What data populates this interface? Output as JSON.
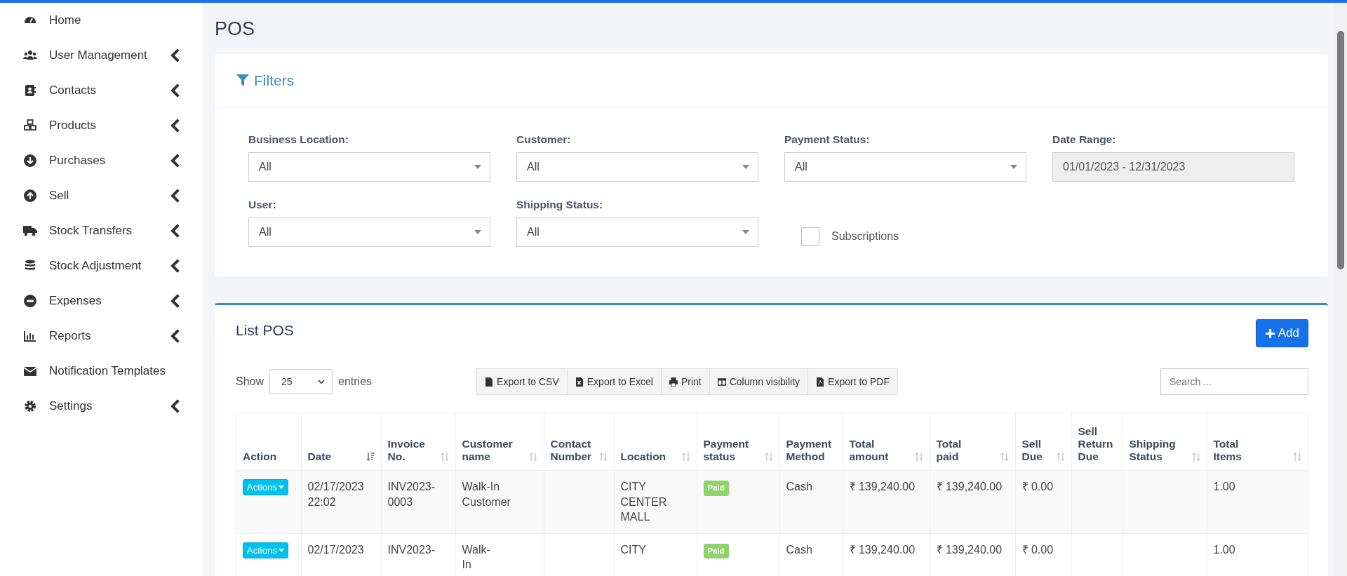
{
  "sidebar": {
    "items": [
      {
        "label": "Home",
        "expandable": false
      },
      {
        "label": "User Management",
        "expandable": true
      },
      {
        "label": "Contacts",
        "expandable": true
      },
      {
        "label": "Products",
        "expandable": true
      },
      {
        "label": "Purchases",
        "expandable": true
      },
      {
        "label": "Sell",
        "expandable": true
      },
      {
        "label": "Stock Transfers",
        "expandable": true
      },
      {
        "label": "Stock Adjustment",
        "expandable": true
      },
      {
        "label": "Expenses",
        "expandable": true
      },
      {
        "label": "Reports",
        "expandable": true
      },
      {
        "label": "Notification Templates",
        "expandable": false
      },
      {
        "label": "Settings",
        "expandable": true
      }
    ]
  },
  "page_title": "POS",
  "filters": {
    "title": "Filters",
    "fields": [
      {
        "kind": "select",
        "label": "Business Location:",
        "value": "All"
      },
      {
        "kind": "select",
        "label": "Customer:",
        "value": "All"
      },
      {
        "kind": "select",
        "label": "Payment Status:",
        "value": "All"
      },
      {
        "kind": "date",
        "label": "Date Range:",
        "value": "01/01/2023 - 12/31/2023"
      },
      {
        "kind": "select",
        "label": "User:",
        "value": "All"
      },
      {
        "kind": "select",
        "label": "Shipping Status:",
        "value": "All"
      },
      {
        "kind": "checkbox",
        "label": "Subscriptions",
        "checked": false
      }
    ]
  },
  "list": {
    "title": "List POS",
    "add_button": "Add",
    "show_label": "Show",
    "page_size": "25",
    "entries_label": "entries",
    "export_buttons": [
      "Export to CSV",
      "Export to Excel",
      "Print",
      "Column visibility",
      "Export to PDF"
    ],
    "search": {
      "placeholder": "Search ..."
    },
    "table": {
      "columns": [
        {
          "label": "Action",
          "sortable": false
        },
        {
          "label": "Date",
          "sortable": true,
          "sorted": true
        },
        {
          "label": "Invoice No.",
          "sortable": true,
          "sorted": false
        },
        {
          "label": "Customer name",
          "sortable": true,
          "sorted": false
        },
        {
          "label": "Contact Number",
          "sortable": true,
          "sorted": false
        },
        {
          "label": "Location",
          "sortable": true,
          "sorted": false
        },
        {
          "label": "Payment status",
          "sortable": true,
          "sorted": false
        },
        {
          "label": "Payment Method",
          "sortable": false
        },
        {
          "label": "Total amount",
          "sortable": true,
          "sorted": false
        },
        {
          "label": "Total paid",
          "sortable": true,
          "sorted": false
        },
        {
          "label": "Sell Due",
          "sortable": true,
          "sorted": false
        },
        {
          "label": "Sell Return Due",
          "sortable": false
        },
        {
          "label": "Shipping Status",
          "sortable": true,
          "sorted": false
        },
        {
          "label": "Total Items",
          "sortable": true,
          "sorted": false
        }
      ],
      "rows": [
        {
          "action": "Actions",
          "date": "02/17/2023 22:02",
          "invoice": "INV2023-0003",
          "customer": "Walk-In Customer",
          "location": "CITY CENTER MALL",
          "payment_status": "Paid",
          "color": "#8fd36b",
          "payment_method": "Cash",
          "total_amount": "₹ 139,240.00",
          "total_paid": "₹ 139,240.00",
          "sell_due": "₹ 0.00",
          "total_items": "1.00"
        },
        {
          "action": "Actions",
          "date": "02/17/2023",
          "invoice": "INV2023-",
          "customer": "Walk-In",
          "location": "CITY",
          "payment_status": "Paid",
          "color": "#8fd36b",
          "payment_method": "Cash",
          "total_amount": "₹ 139,240.00",
          "total_paid": "₹ 139,240.00",
          "sell_due": "₹ 0.00",
          "total_items": "1.00"
        }
      ]
    }
  }
}
